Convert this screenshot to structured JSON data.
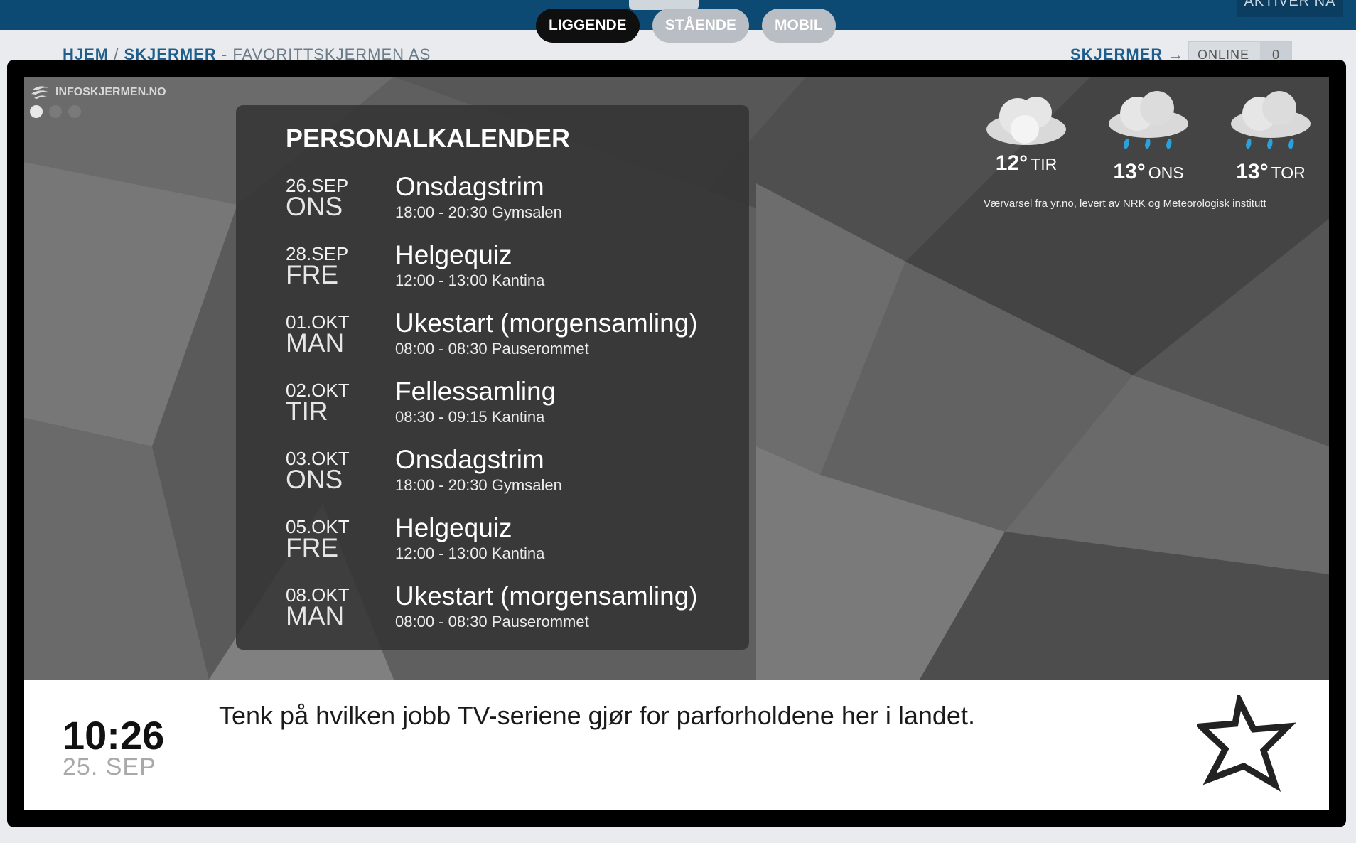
{
  "header": {
    "activate_label": "AKTIVER NÅ",
    "breadcrumb": {
      "home": "HJEM",
      "sep": "/",
      "screens": "SKJERMER",
      "dash": "-",
      "site": "FAVORITTSKJERMEN AS"
    },
    "right_nav": {
      "screens": "SKJERMER",
      "arrow": "→",
      "online_label": "ONLINE",
      "online_count": "0"
    }
  },
  "tabs": [
    {
      "label": "LIGGENDE",
      "active": true
    },
    {
      "label": "STÅENDE",
      "active": false
    },
    {
      "label": "MOBIL",
      "active": false
    }
  ],
  "screen": {
    "brand": "INFOSKJERMEN.NO",
    "slide_count": 3,
    "active_slide": 1,
    "calendar": {
      "title": "PERSONALKALENDER",
      "events": [
        {
          "date": "26.SEP",
          "dow": "ONS",
          "title": "Onsdagstrim",
          "time": "18:00 - 20:30 Gymsalen"
        },
        {
          "date": "28.SEP",
          "dow": "FRE",
          "title": "Helgequiz",
          "time": "12:00 - 13:00 Kantina"
        },
        {
          "date": "01.OKT",
          "dow": "MAN",
          "title": "Ukestart (morgensamling)",
          "time": "08:00 - 08:30 Pauserommet"
        },
        {
          "date": "02.OKT",
          "dow": "TIR",
          "title": "Fellessamling",
          "time": "08:30 - 09:15 Kantina"
        },
        {
          "date": "03.OKT",
          "dow": "ONS",
          "title": "Onsdagstrim",
          "time": "18:00 - 20:30 Gymsalen"
        },
        {
          "date": "05.OKT",
          "dow": "FRE",
          "title": "Helgequiz",
          "time": "12:00 - 13:00 Kantina"
        },
        {
          "date": "08.OKT",
          "dow": "MAN",
          "title": "Ukestart (morgensamling)",
          "time": "08:00 - 08:30 Pauserommet"
        }
      ]
    },
    "weather": {
      "days": [
        {
          "temp": "12°",
          "day": "TIR",
          "icon": "cloudy-sun-icon"
        },
        {
          "temp": "13°",
          "day": "ONS",
          "icon": "rain-cloud-icon"
        },
        {
          "temp": "13°",
          "day": "TOR",
          "icon": "rain-cloud-icon"
        }
      ],
      "credit": "Værvarsel fra yr.no, levert av NRK og Meteorologisk institutt"
    },
    "footer": {
      "time": "10:26",
      "date": "25. SEP",
      "quote": "Tenk på hvilken jobb TV-seriene gjør for parforholdene her i landet.",
      "icon": "star-icon"
    }
  },
  "colors": {
    "header": "#0d4a73",
    "accent_link": "#1f5e8c",
    "rain": "#2aa0dc"
  }
}
